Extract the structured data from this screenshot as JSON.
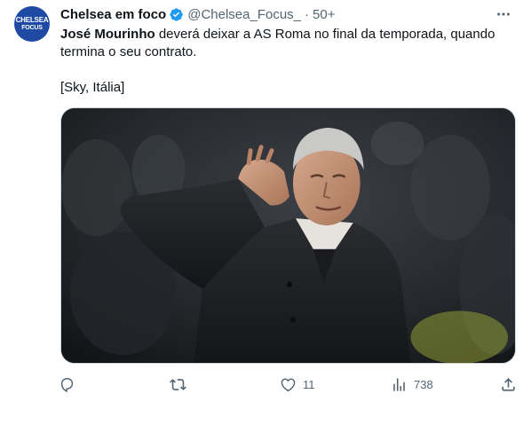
{
  "author": {
    "display_name": "Chelsea em foco",
    "handle": "@Chelsea_Focus_",
    "separator": "·",
    "timestamp": "50+",
    "avatar_text_line1": "CHELSEA",
    "avatar_text_line2": "FOCUS",
    "avatar_color": "#1f4aa3",
    "verified_color": "#1d9bf0"
  },
  "tweet": {
    "text_bold": "José Mourinho",
    "text_rest": " deverá deixar a AS Roma no final da temporada, quando termina o seu contrato.",
    "source": "[Sky, Itália]",
    "media_icon": "photo-mourinho-ear-gesture"
  },
  "actions": {
    "reply": {
      "icon": "reply-icon",
      "count": ""
    },
    "retweet": {
      "icon": "retweet-icon",
      "count": ""
    },
    "like": {
      "icon": "heart-icon",
      "count": "11"
    },
    "views": {
      "icon": "views-icon",
      "count": "738"
    },
    "share": {
      "icon": "share-icon"
    }
  },
  "colors": {
    "text_primary": "#0f1419",
    "text_secondary": "#536471",
    "border": "#cfd9de"
  }
}
